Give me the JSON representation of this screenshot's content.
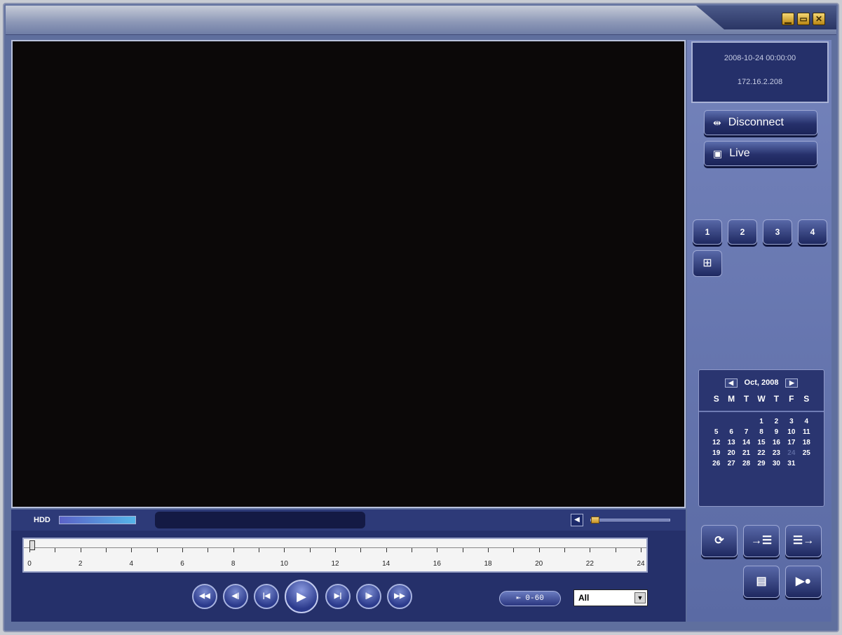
{
  "window": {
    "minimize_glyph": "▁",
    "maximize_glyph": "▭",
    "close_glyph": "✕"
  },
  "info": {
    "datetime": "2008-10-24 00:00:00",
    "ip": "172.16.2.208"
  },
  "buttons": {
    "disconnect": "Disconnect",
    "live": "Live"
  },
  "channels": [
    "1",
    "2",
    "3",
    "4"
  ],
  "calendar": {
    "month": "Oct, 2008",
    "dow": [
      "S",
      "M",
      "T",
      "W",
      "T",
      "F",
      "S"
    ],
    "days": [
      "",
      "",
      "",
      "1",
      "2",
      "3",
      "4",
      "5",
      "6",
      "7",
      "8",
      "9",
      "10",
      "11",
      "12",
      "13",
      "14",
      "15",
      "16",
      "17",
      "18",
      "19",
      "20",
      "21",
      "22",
      "23",
      "24",
      "25",
      "26",
      "27",
      "28",
      "29",
      "30",
      "31",
      ""
    ],
    "selected_day": "24"
  },
  "hdd": {
    "label": "HDD",
    "usage_fraction": 1.0
  },
  "volume": {
    "level_fraction": 0.0
  },
  "timeline": {
    "labels": [
      "0",
      "2",
      "4",
      "6",
      "8",
      "10",
      "12",
      "14",
      "16",
      "18",
      "20",
      "22",
      "24"
    ],
    "position_hours": 0
  },
  "playback": {
    "range_label": "⇤ 0-60",
    "filter_value": "All"
  }
}
